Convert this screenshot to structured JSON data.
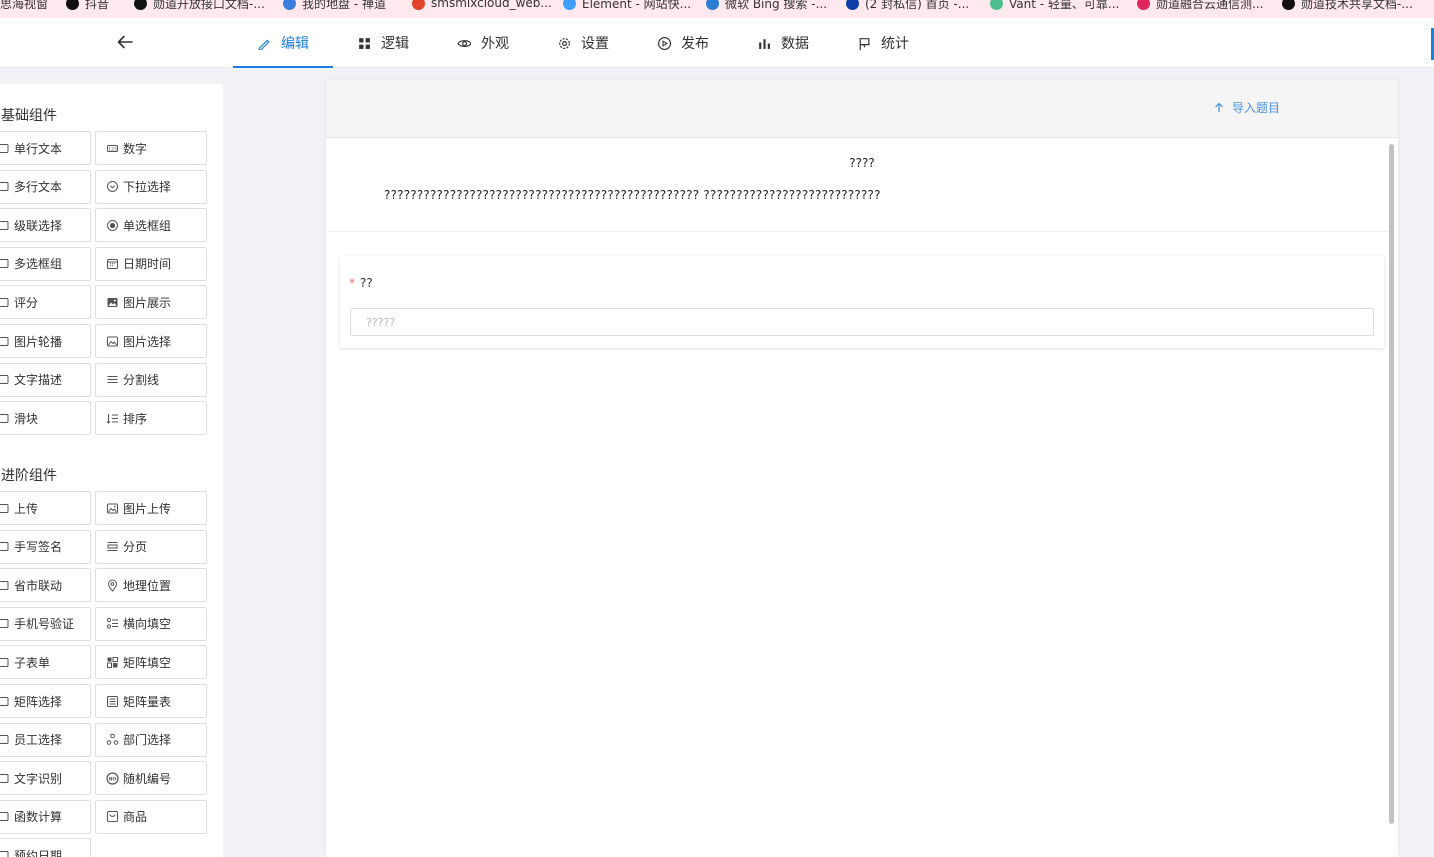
{
  "bookmarks": [
    {
      "label": "思海视窗",
      "color": "#d9534f"
    },
    {
      "label": "抖音",
      "color": "#111111"
    },
    {
      "label": "勋道开放接口文档-...",
      "color": "#111111"
    },
    {
      "label": "我的地盘 - 禅道",
      "color": "#3b7ddd"
    },
    {
      "label": "smsmixcloud_web...",
      "color": "#e24329"
    },
    {
      "label": "Element - 网站快...",
      "color": "#409eff"
    },
    {
      "label": "微软 Bing 搜索 -...",
      "color": "#2b7cd3"
    },
    {
      "label": "(2 封私信) 首页 -...",
      "color": "#0f3fa8"
    },
    {
      "label": "Vant - 轻量、可靠...",
      "color": "#4fc08d"
    },
    {
      "label": "勋道融合云通信测...",
      "color": "#e0245e"
    },
    {
      "label": "勋道技术共享文档-...",
      "color": "#111111"
    }
  ],
  "header": {
    "tabs": [
      {
        "label": "编辑",
        "icon": "edit-icon",
        "active": true
      },
      {
        "label": "逻辑",
        "icon": "grid-icon",
        "active": false
      },
      {
        "label": "外观",
        "icon": "eye-icon",
        "active": false
      },
      {
        "label": "设置",
        "icon": "gear-icon",
        "active": false
      },
      {
        "label": "发布",
        "icon": "play-circle-icon",
        "active": false
      },
      {
        "label": "数据",
        "icon": "bar-chart-icon",
        "active": false
      },
      {
        "label": "统计",
        "icon": "flag-icon",
        "active": false
      }
    ]
  },
  "sidebar": {
    "basic_title": "基础组件",
    "basic": [
      {
        "label": "单行文本",
        "icon": "input-icon"
      },
      {
        "label": "数字",
        "icon": "number-icon"
      },
      {
        "label": "多行文本",
        "icon": "textarea-icon"
      },
      {
        "label": "下拉选择",
        "icon": "chevron-circle-icon"
      },
      {
        "label": "级联选择",
        "icon": "cascade-icon"
      },
      {
        "label": "单选框组",
        "icon": "radio-icon"
      },
      {
        "label": "多选框组",
        "icon": "checkbox-icon"
      },
      {
        "label": "日期时间",
        "icon": "calendar-icon"
      },
      {
        "label": "评分",
        "icon": "star-icon"
      },
      {
        "label": "图片展示",
        "icon": "image-icon"
      },
      {
        "label": "图片轮播",
        "icon": "carousel-icon"
      },
      {
        "label": "图片选择",
        "icon": "image-select-icon"
      },
      {
        "label": "文字描述",
        "icon": "text-icon"
      },
      {
        "label": "分割线",
        "icon": "divider-icon"
      },
      {
        "label": "滑块",
        "icon": "slider-icon"
      },
      {
        "label": "排序",
        "icon": "sort-icon"
      }
    ],
    "advanced_title": "进阶组件",
    "advanced": [
      {
        "label": "上传",
        "icon": "upload-icon"
      },
      {
        "label": "图片上传",
        "icon": "image-upload-icon"
      },
      {
        "label": "手写签名",
        "icon": "signature-icon"
      },
      {
        "label": "分页",
        "icon": "pagination-icon"
      },
      {
        "label": "省市联动",
        "icon": "region-icon"
      },
      {
        "label": "地理位置",
        "icon": "location-icon"
      },
      {
        "label": "手机号验证",
        "icon": "phone-icon"
      },
      {
        "label": "横向填空",
        "icon": "fill-blank-icon"
      },
      {
        "label": "子表单",
        "icon": "subform-icon"
      },
      {
        "label": "矩阵填空",
        "icon": "matrix-fill-icon"
      },
      {
        "label": "矩阵选择",
        "icon": "matrix-select-icon"
      },
      {
        "label": "矩阵量表",
        "icon": "matrix-scale-icon"
      },
      {
        "label": "员工选择",
        "icon": "user-icon"
      },
      {
        "label": "部门选择",
        "icon": "department-icon"
      },
      {
        "label": "文字识别",
        "icon": "ocr-icon"
      },
      {
        "label": "随机编号",
        "icon": "no-badge-icon"
      },
      {
        "label": "函数计算",
        "icon": "function-icon"
      },
      {
        "label": "商品",
        "icon": "product-icon"
      },
      {
        "label": "预约日期",
        "icon": "booking-icon"
      }
    ]
  },
  "canvas": {
    "import_label": "导入题目",
    "form_title": "????",
    "form_description": "???????????????????????????????????????????????? ???????????????????????????",
    "field": {
      "required_mark": "*",
      "label": "??",
      "placeholder": "?????"
    }
  },
  "colors": {
    "accent": "#1e7ee3",
    "link": "#4a90e2",
    "required": "#f56c6c",
    "bookmarks_bg": "#ffe8ee"
  }
}
